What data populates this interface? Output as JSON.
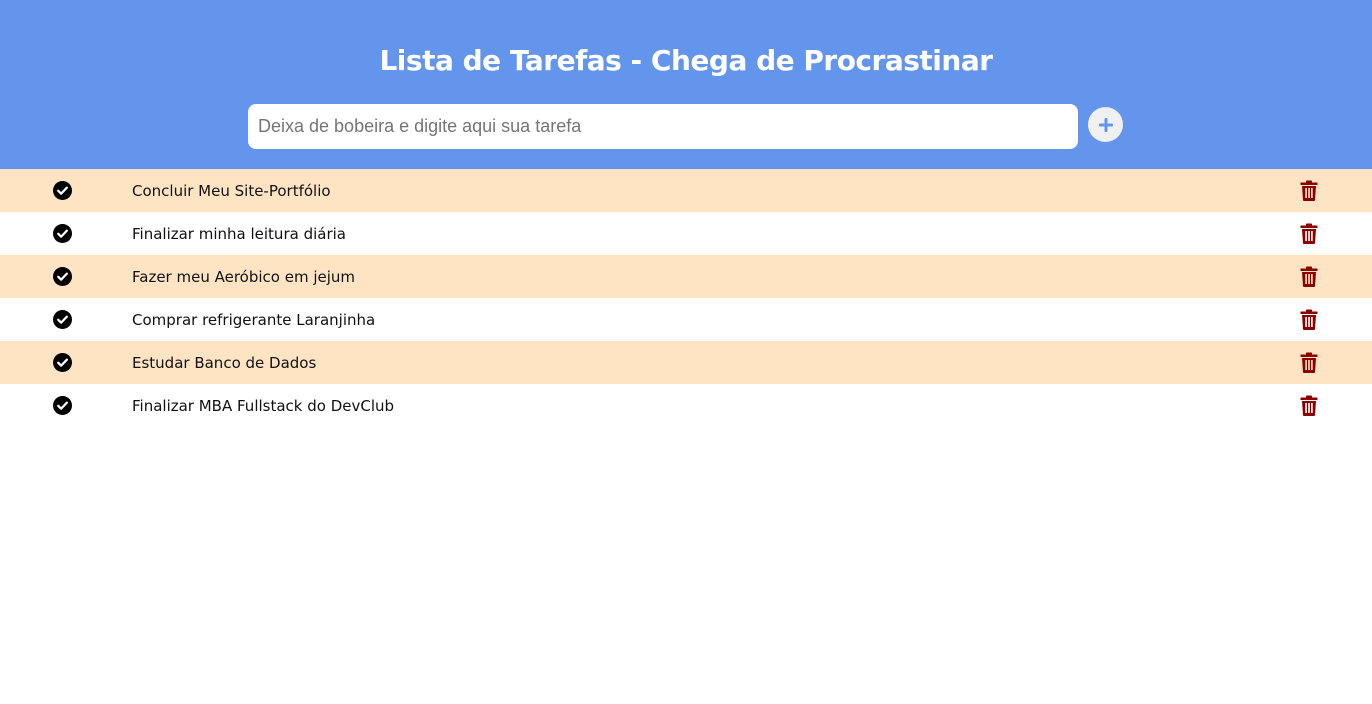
{
  "header": {
    "title": "Lista de Tarefas - Chega de Procrastinar",
    "background_color": "#6495ed"
  },
  "input": {
    "value": "",
    "placeholder": "Deixa de bobeira e digite aqui sua tarefa"
  },
  "add_button": {
    "icon": "plus-icon"
  },
  "tasks": [
    {
      "text": "Concluir Meu Site-Portfólio",
      "check_icon": "check-circle-icon",
      "delete_icon": "trash-icon"
    },
    {
      "text": "Finalizar minha leitura diária",
      "check_icon": "check-circle-icon",
      "delete_icon": "trash-icon"
    },
    {
      "text": "Fazer meu Aeróbico em jejum",
      "check_icon": "check-circle-icon",
      "delete_icon": "trash-icon"
    },
    {
      "text": "Comprar refrigerante Laranjinha",
      "check_icon": "check-circle-icon",
      "delete_icon": "trash-icon"
    },
    {
      "text": "Estudar Banco de Dados",
      "check_icon": "check-circle-icon",
      "delete_icon": "trash-icon"
    },
    {
      "text": "Finalizar MBA Fullstack do DevClub",
      "check_icon": "check-circle-icon",
      "delete_icon": "trash-icon"
    }
  ],
  "colors": {
    "row_alt": "#ffe4c4",
    "trash": "#8b0000"
  }
}
